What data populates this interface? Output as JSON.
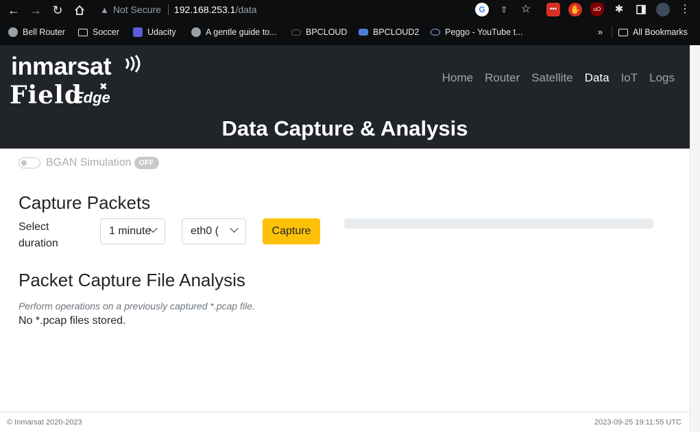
{
  "browser": {
    "security_label": "Not Secure",
    "url_host": "192.168.253.1",
    "url_path": "/data",
    "bookmarks": [
      {
        "label": "Bell Router",
        "icon": "globe-icon"
      },
      {
        "label": "Soccer",
        "icon": "folder-icon"
      },
      {
        "label": "Udacity",
        "icon": "udacity-icon"
      },
      {
        "label": "A gentle guide to...",
        "icon": "globe-icon"
      },
      {
        "label": "BPCLOUD",
        "icon": "cloud-icon"
      },
      {
        "label": "BPCLOUD2",
        "icon": "wd-icon"
      },
      {
        "label": "Peggo - YouTube t...",
        "icon": "cloud-download-icon"
      }
    ],
    "overflow_label": "»",
    "all_bookmarks_label": "All Bookmarks"
  },
  "header": {
    "logo_line1": "inmarsat",
    "logo_field": "Field",
    "logo_edge": "Edge",
    "nav": [
      {
        "label": "Home",
        "active": false
      },
      {
        "label": "Router",
        "active": false
      },
      {
        "label": "Satellite",
        "active": false
      },
      {
        "label": "Data",
        "active": true
      },
      {
        "label": "IoT",
        "active": false
      },
      {
        "label": "Logs",
        "active": false
      }
    ],
    "page_title": "Data Capture & Analysis"
  },
  "simulation": {
    "label": "BGAN Simulation",
    "state_badge": "OFF",
    "enabled": false
  },
  "capture": {
    "heading": "Capture Packets",
    "duration_label": "Select duration",
    "duration_value": "1 minute",
    "interface_value": "eth0 (",
    "button_label": "Capture",
    "progress": 0
  },
  "analysis": {
    "heading": "Packet Capture File Analysis",
    "hint": "Perform operations on a previously captured *.pcap file.",
    "empty_message": "No *.pcap files stored."
  },
  "footer": {
    "copyright": "© Inmarsat 2020-2023",
    "timestamp": "2023-09-25 19:11:55 UTC"
  },
  "colors": {
    "header_bg": "#212529",
    "accent_button": "#ffc107",
    "browser_bg": "#0c0e10"
  }
}
